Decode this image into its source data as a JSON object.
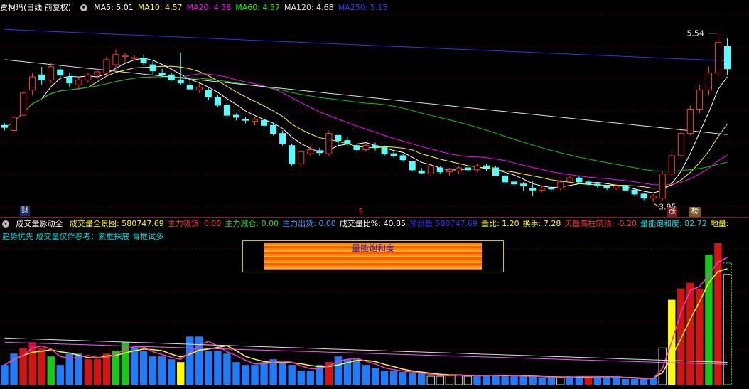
{
  "header": {
    "stock_title": "贾柯玛(日线 前复权)",
    "ma": [
      {
        "label": "MA5: 5.01",
        "color": "#ffffff"
      },
      {
        "label": "MA10: 4.57",
        "color": "#ffff00"
      },
      {
        "label": "MA20: 4.38",
        "color": "#ff00ff"
      },
      {
        "label": "MA60: 4.57",
        "color": "#00ff00"
      },
      {
        "label": "MA120: 4.68",
        "color": "#e0e0e0"
      },
      {
        "label": "MA250: 5.15",
        "color": "#3333ff"
      }
    ]
  },
  "price_panel": {
    "high_label": "5.54",
    "low_label": "3.95",
    "markers": {
      "cai": "财",
      "dollar": "$",
      "zhang": "涨",
      "bang": "榜"
    }
  },
  "indicator_header": {
    "name": "成交量脉动全",
    "items": [
      {
        "label": "成交量全景图: ",
        "value": "580747.69",
        "color": "#ffff00"
      },
      {
        "label": "主力吸货: ",
        "value": "0.00",
        "color": "#ff3333"
      },
      {
        "label": "主力减仓: ",
        "value": "0.00",
        "color": "#22dd22"
      },
      {
        "label": "主力出货: ",
        "value": "0.00",
        "color": "#3399ff"
      },
      {
        "label": "成交量比%: ",
        "value": "40.85",
        "color": "#ffffff"
      },
      {
        "label": "预测量 ",
        "value": "580747.69",
        "color": "#3333ff"
      },
      {
        "label": "量比: ",
        "value": "1.20",
        "color": "#ffff00"
      },
      {
        "label": "换手: ",
        "value": "7.28",
        "color": "#ffff00"
      },
      {
        "label": "天量高柱筑顶: ",
        "value": "-0.20",
        "color": "#ff3333"
      },
      {
        "label": "量能饱和度: ",
        "value": "82.72",
        "color": "#00dddd"
      },
      {
        "label": "地量:",
        "value": "",
        "color": "#ffff00"
      }
    ]
  },
  "indicator_note": "趋势优先 成交量仅作参考：紫框探底 青框试多",
  "saturation_label": "量能饱和度",
  "chart_data": {
    "type": "candlestick",
    "title": "贾柯玛(日线 前复权)",
    "ylim": [
      3.8,
      5.7
    ],
    "candles": [
      [
        4.6,
        4.62,
        4.55,
        4.58
      ],
      [
        4.55,
        4.7,
        4.52,
        4.68
      ],
      [
        4.7,
        4.95,
        4.68,
        4.92
      ],
      [
        4.95,
        5.12,
        4.9,
        5.08
      ],
      [
        5.1,
        5.18,
        5.0,
        5.05
      ],
      [
        5.05,
        5.22,
        5.02,
        5.18
      ],
      [
        5.15,
        5.2,
        5.05,
        5.1
      ],
      [
        5.08,
        5.12,
        4.98,
        5.02
      ],
      [
        5.0,
        5.08,
        4.95,
        5.05
      ],
      [
        5.05,
        5.12,
        5.02,
        5.1
      ],
      [
        5.1,
        5.16,
        5.06,
        5.13
      ],
      [
        5.12,
        5.28,
        5.08,
        5.25
      ],
      [
        5.2,
        5.35,
        5.15,
        5.3
      ],
      [
        5.28,
        5.32,
        5.22,
        5.29
      ],
      [
        5.27,
        5.3,
        5.24,
        5.27
      ],
      [
        5.26,
        5.3,
        5.2,
        5.22
      ],
      [
        5.2,
        5.24,
        5.1,
        5.14
      ],
      [
        5.12,
        5.16,
        5.08,
        5.1
      ],
      [
        5.1,
        5.12,
        5.04,
        5.05
      ],
      [
        5.05,
        5.32,
        5.0,
        5.02
      ],
      [
        5.0,
        5.05,
        4.95,
        4.96
      ],
      [
        4.95,
        5.02,
        4.92,
        4.98
      ],
      [
        4.95,
        4.98,
        4.85,
        4.88
      ],
      [
        4.88,
        4.9,
        4.78,
        4.8
      ],
      [
        4.8,
        4.82,
        4.68,
        4.7
      ],
      [
        4.7,
        4.72,
        4.65,
        4.68
      ],
      [
        4.66,
        4.68,
        4.62,
        4.65
      ],
      [
        4.64,
        4.68,
        4.6,
        4.66
      ],
      [
        4.65,
        4.66,
        4.58,
        4.6
      ],
      [
        4.6,
        4.62,
        4.5,
        4.52
      ],
      [
        4.52,
        4.55,
        4.4,
        4.42
      ],
      [
        4.4,
        4.42,
        4.2,
        4.22
      ],
      [
        4.22,
        4.36,
        4.2,
        4.34
      ],
      [
        4.32,
        4.4,
        4.3,
        4.36
      ],
      [
        4.35,
        4.38,
        4.3,
        4.33
      ],
      [
        4.32,
        4.55,
        4.3,
        4.52
      ],
      [
        4.5,
        4.52,
        4.4,
        4.45
      ],
      [
        4.45,
        4.48,
        4.4,
        4.42
      ],
      [
        4.4,
        4.42,
        4.34,
        4.36
      ],
      [
        4.36,
        4.42,
        4.34,
        4.4
      ],
      [
        4.4,
        4.43,
        4.35,
        4.38
      ],
      [
        4.38,
        4.4,
        4.3,
        4.32
      ],
      [
        4.32,
        4.35,
        4.28,
        4.3
      ],
      [
        4.3,
        4.32,
        4.24,
        4.26
      ],
      [
        4.24,
        4.25,
        4.15,
        4.16
      ],
      [
        4.15,
        4.18,
        4.12,
        4.13
      ],
      [
        4.12,
        4.22,
        4.1,
        4.2
      ],
      [
        4.18,
        4.2,
        4.12,
        4.14
      ],
      [
        4.14,
        4.18,
        4.1,
        4.16
      ],
      [
        4.15,
        4.2,
        4.12,
        4.18
      ],
      [
        4.18,
        4.2,
        4.14,
        4.16
      ],
      [
        4.16,
        4.22,
        4.14,
        4.2
      ],
      [
        4.2,
        4.22,
        4.15,
        4.18
      ],
      [
        4.18,
        4.2,
        4.1,
        4.1
      ],
      [
        4.1,
        4.12,
        4.02,
        4.04
      ],
      [
        4.04,
        4.06,
        4.0,
        4.02
      ],
      [
        4.02,
        4.04,
        3.95,
        4.0
      ],
      [
        3.98,
        4.05,
        3.9,
        3.96
      ],
      [
        3.96,
        4.0,
        3.94,
        3.98
      ],
      [
        3.98,
        4.0,
        3.94,
        3.97
      ],
      [
        3.98,
        4.06,
        3.96,
        4.04
      ],
      [
        4.05,
        4.1,
        4.04,
        4.08
      ],
      [
        4.08,
        4.1,
        4.02,
        4.04
      ],
      [
        4.04,
        4.06,
        4.0,
        4.02
      ],
      [
        4.02,
        4.04,
        3.98,
        4.0
      ],
      [
        4.0,
        4.01,
        3.96,
        3.98
      ],
      [
        3.98,
        4.02,
        3.96,
        4.0
      ],
      [
        4.0,
        4.01,
        3.95,
        3.96
      ],
      [
        3.96,
        3.97,
        3.9,
        3.92
      ],
      [
        3.92,
        3.93,
        3.86,
        3.88
      ],
      [
        3.88,
        3.92,
        3.84,
        3.9
      ],
      [
        3.88,
        4.15,
        3.86,
        4.12
      ],
      [
        4.12,
        4.35,
        4.1,
        4.3
      ],
      [
        4.3,
        4.55,
        4.28,
        4.52
      ],
      [
        4.52,
        4.8,
        4.5,
        4.76
      ],
      [
        4.76,
        5.0,
        4.72,
        4.95
      ],
      [
        4.95,
        5.18,
        4.9,
        5.12
      ],
      [
        5.12,
        5.54,
        5.08,
        5.42
      ],
      [
        5.38,
        5.46,
        5.1,
        5.16
      ]
    ],
    "volume_ylim": [
      0,
      100
    ],
    "volume_levels": [
      14,
      22,
      26,
      30,
      26,
      20,
      14,
      22,
      22,
      18,
      18,
      22,
      24,
      30,
      26,
      24,
      20,
      20,
      18,
      16,
      34,
      34,
      24,
      24,
      22,
      16,
      14,
      14,
      16,
      18,
      16,
      14,
      10,
      10,
      14,
      16,
      20,
      18,
      18,
      14,
      12,
      10,
      10,
      9,
      8,
      8,
      6,
      6,
      7,
      7,
      6,
      6,
      7,
      7,
      6,
      6,
      6,
      6,
      5,
      5,
      5,
      6,
      6,
      5,
      6,
      5,
      6,
      4,
      4,
      4,
      5,
      26,
      60,
      68,
      72,
      68,
      92,
      100,
      78
    ],
    "volume_colors": [
      "blue",
      "blue",
      "red",
      "red",
      "red",
      "green",
      "blue",
      "blue",
      "blue",
      "red",
      "red",
      "red",
      "green",
      "green",
      "blue",
      "blue",
      "blue",
      "blue",
      "blue",
      "yellow",
      "blue",
      "blue",
      "blue",
      "blue",
      "blue",
      "blue",
      "blue",
      "blue",
      "blue",
      "blue",
      "blue",
      "blue",
      "blue",
      "blue",
      "blue",
      "red",
      "blue",
      "blue",
      "blue",
      "blue",
      "blue",
      "blue",
      "blue",
      "blue",
      "blue",
      "blue",
      "hollow",
      "hollow",
      "hollow",
      "hollow",
      "hollow",
      "blue",
      "blue",
      "blue",
      "blue",
      "blue",
      "blue",
      "blue",
      "blue",
      "blue",
      "hollow",
      "blue",
      "blue",
      "red",
      "blue",
      "blue",
      "blue",
      "blue",
      "blue",
      "blue",
      "blue",
      "hollow",
      "yellow",
      "red",
      "red",
      "red",
      "green",
      "red",
      "hollow"
    ]
  }
}
